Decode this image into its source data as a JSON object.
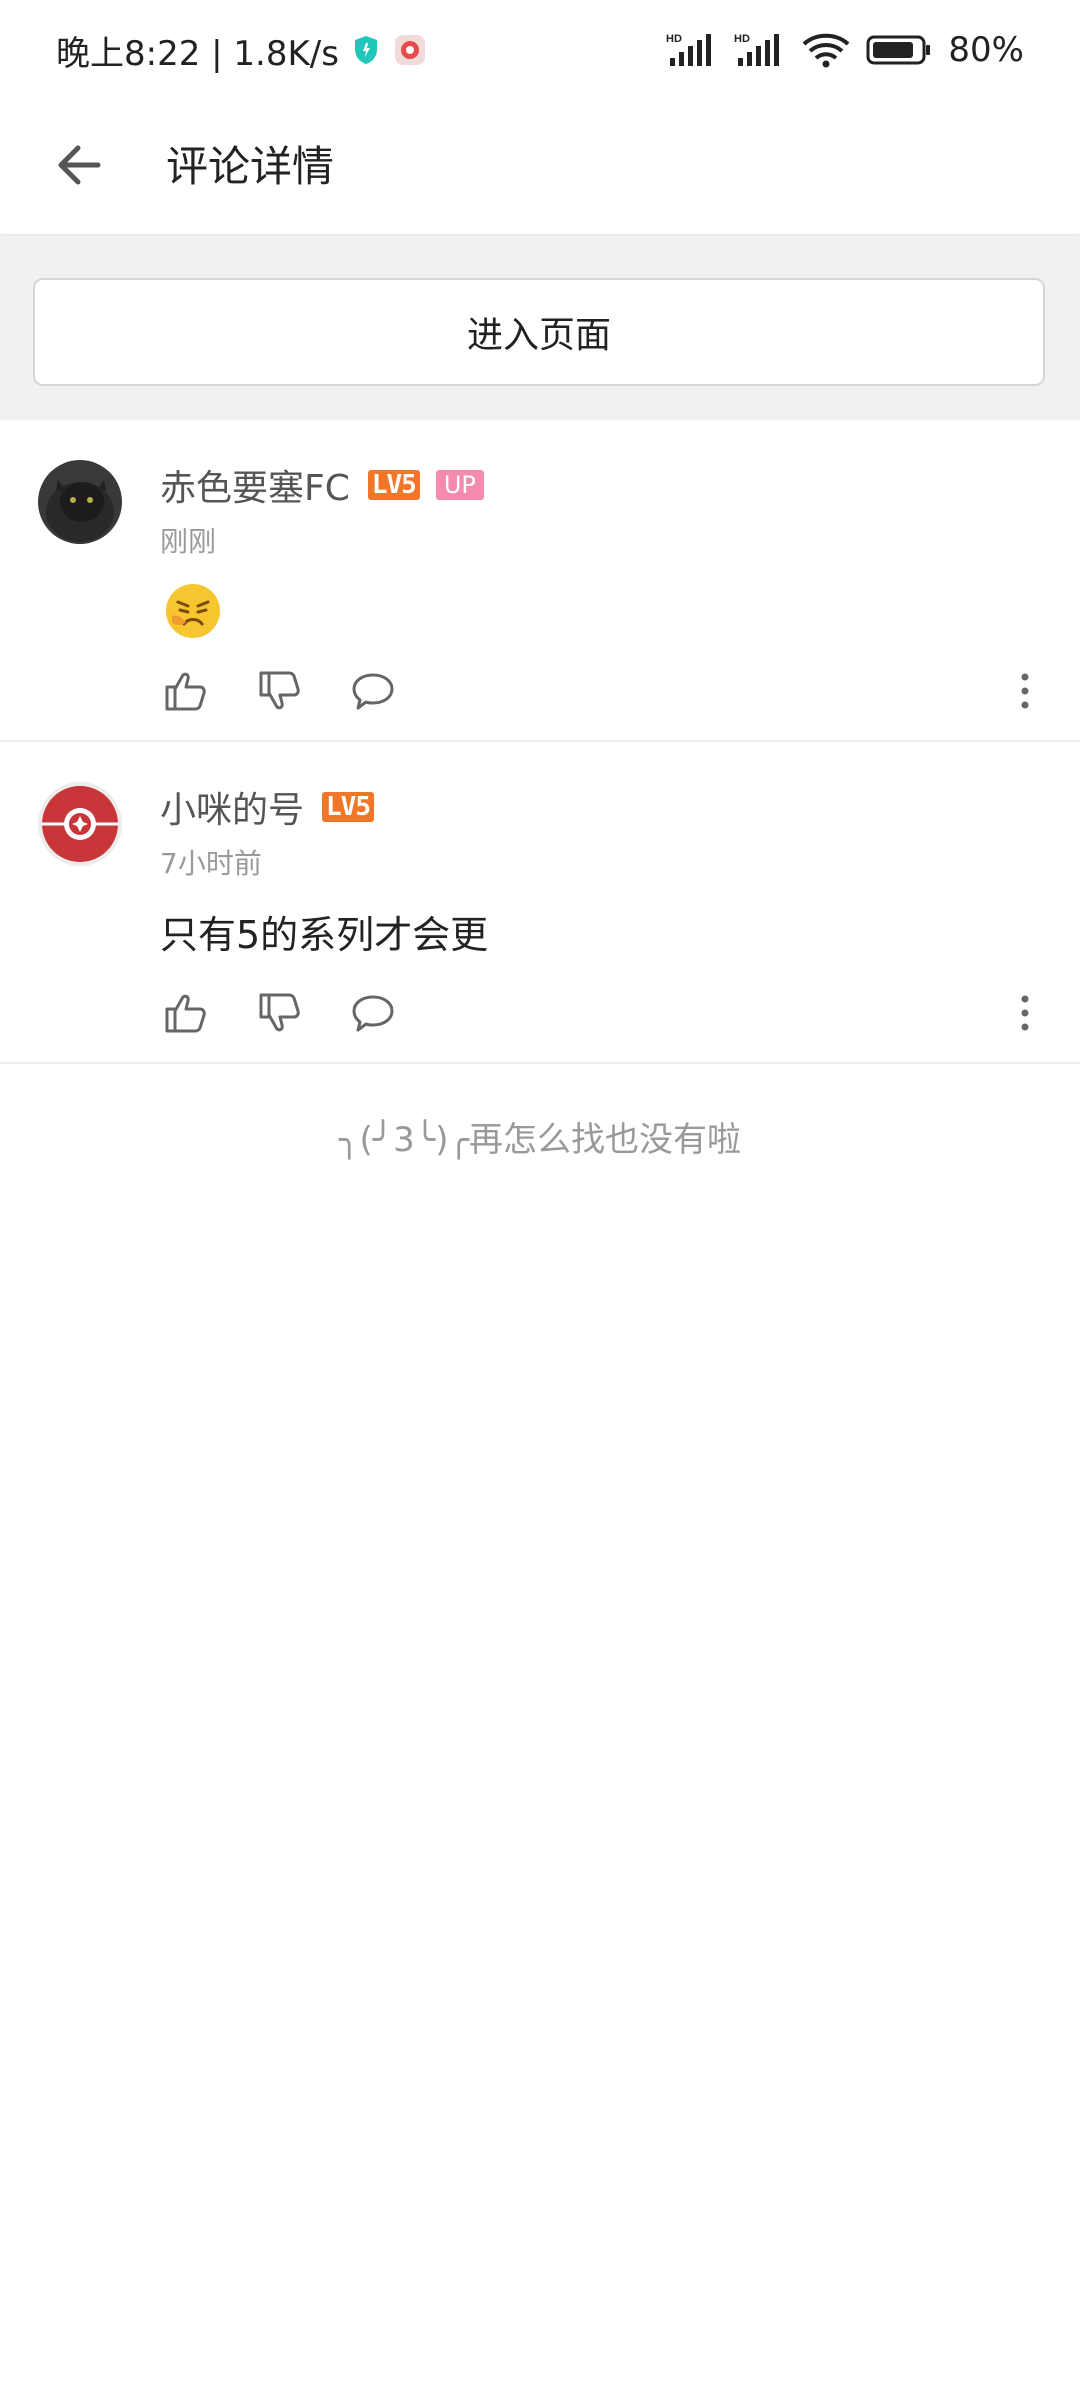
{
  "status_bar": {
    "time_speed": "晚上8:22 | 1.8K/s",
    "signal_label_1": "HD",
    "signal_label_2": "HD",
    "battery": "80%"
  },
  "header": {
    "title": "评论详情"
  },
  "enter_page": {
    "label": "进入页面"
  },
  "comments": [
    {
      "username": "赤色要塞FC",
      "level": "LV5",
      "up_badge": "UP",
      "time": "刚刚",
      "content_type": "emoji",
      "content_icon": "angry-face-emoji-icon"
    },
    {
      "username": "小咪的号",
      "level": "LV5",
      "time": "7小时前",
      "content": "只有5的系列才会更"
    }
  ],
  "footer_note": "╮(╯3╰)╭再怎么找也没有啦",
  "colors": {
    "level_badge": "#f0762a",
    "up_badge": "#f58ab0",
    "gray_bg": "#f1f1f3"
  }
}
